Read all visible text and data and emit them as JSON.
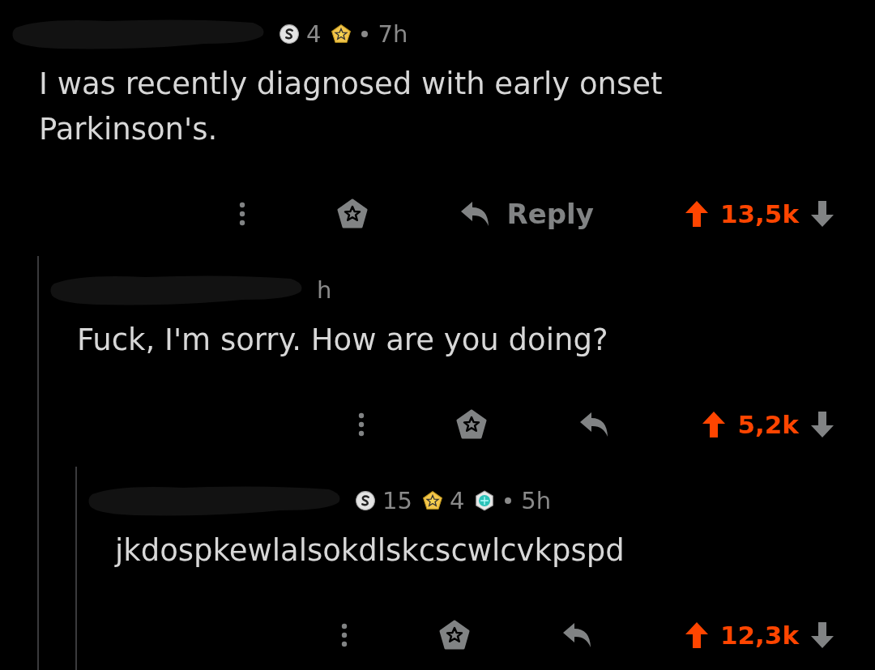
{
  "comments": [
    {
      "badges": [
        {
          "kind": "silver",
          "count": "4"
        },
        {
          "kind": "gold"
        }
      ],
      "time": "7h",
      "body": "I was recently diagnosed with early onset Parkinson's.",
      "reply_label": "Reply",
      "score": "13,5k",
      "upvoted": true,
      "children": [
        {
          "time": "h",
          "body": "Fuck, I'm sorry. How are you doing?",
          "score": "5,2k",
          "upvoted": true,
          "children": [
            {
              "badges": [
                {
                  "kind": "silver",
                  "count": "15"
                },
                {
                  "kind": "gold",
                  "count": "4"
                },
                {
                  "kind": "platinum"
                }
              ],
              "time": "5h",
              "body": "jkdospkewlalsokdlskcscwlcvkpspd",
              "score": "12,3k",
              "upvoted": true
            }
          ]
        }
      ]
    }
  ]
}
